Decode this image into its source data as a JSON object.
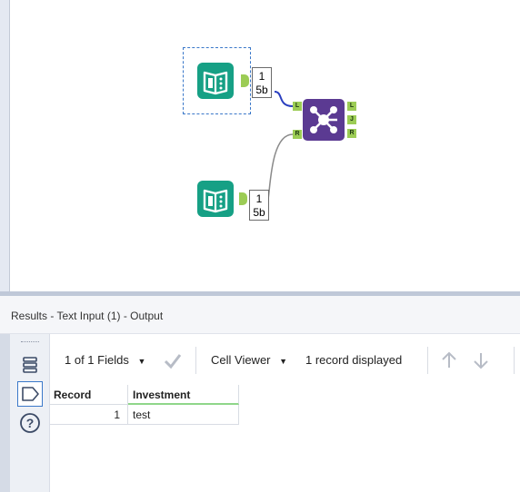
{
  "canvas": {
    "input_tool_1": {
      "badge_line1": "1",
      "badge_line2": "5b"
    },
    "input_tool_2": {
      "badge_line1": "1",
      "badge_line2": "5b"
    },
    "join_tool": {
      "ports_in": [
        "L",
        "R"
      ],
      "ports_out": [
        "L",
        "J",
        "R"
      ]
    },
    "colors": {
      "input_tool": "#16a085",
      "join_tool": "#5b3a92",
      "anchor": "#9ccc55",
      "connection_selected": "#2a3fbf",
      "connection": "#8a8a8a"
    }
  },
  "results": {
    "title": "Results - Text Input (1) - Output",
    "toolbar": {
      "fields_selector": "1 of 1 Fields",
      "cell_viewer": "Cell Viewer",
      "records_status": "1 record displayed"
    },
    "table": {
      "columns": [
        "Record",
        "Investment"
      ],
      "rows": [
        {
          "record": "1",
          "investment": "test"
        }
      ]
    }
  }
}
